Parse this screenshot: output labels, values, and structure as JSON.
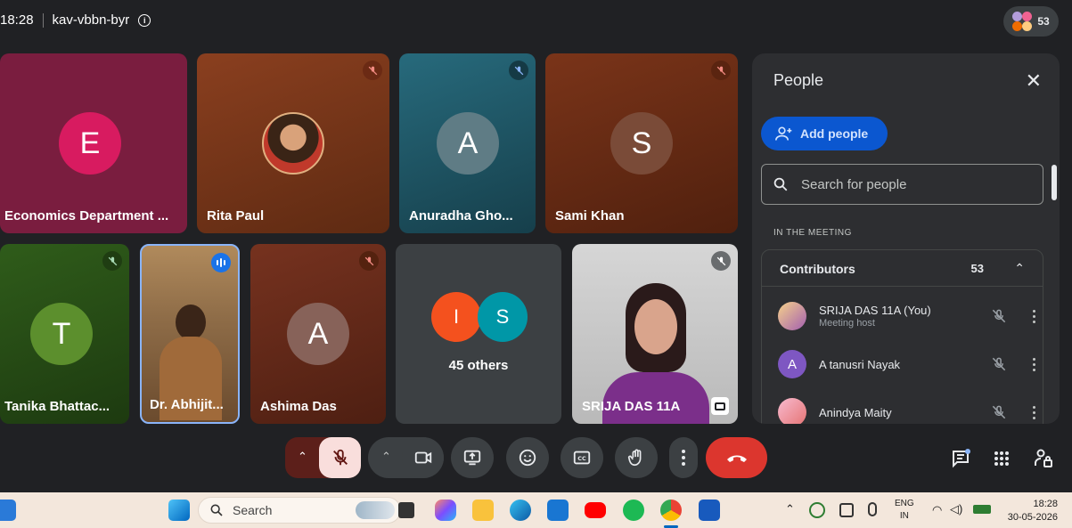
{
  "topbar": {
    "time": "18:28",
    "meeting_code": "kav-vbbn-byr",
    "participant_count": "53"
  },
  "tiles": [
    {
      "name": "Economics Department ...",
      "initial": "E",
      "mic_muted": false,
      "bg": "#7a1d3f",
      "avatar_color": "#d81b60"
    },
    {
      "name": "Rita Paul",
      "initial": "",
      "mic_muted": true,
      "bg": "#7a3519",
      "avatar_color": "#c97f43"
    },
    {
      "name": "Anuradha Gho...",
      "initial": "A",
      "mic_muted": true,
      "bg": "#1d5161",
      "avatar_color": "#5f7c85"
    },
    {
      "name": "Sami Khan",
      "initial": "S",
      "mic_muted": true,
      "bg": "#6d2e16",
      "avatar_color": "#7a4b38"
    },
    {
      "name": "Tanika Bhattac...",
      "initial": "T",
      "mic_muted": true,
      "bg": "#254a16",
      "avatar_color": "#5c8f2d"
    },
    {
      "name": "Dr. Abhijit...",
      "initial": "",
      "mic_muted": false,
      "speaking": true,
      "bg": "#8a6a48",
      "avatar_color": ""
    },
    {
      "name": "Ashima Das",
      "initial": "A",
      "mic_muted": true,
      "bg": "#6a2a1b",
      "avatar_color": "#876259"
    },
    {
      "name": "45 others",
      "initials": [
        "I",
        "S"
      ],
      "avatar_colors": [
        "#f4511e",
        "#0097a7"
      ],
      "bg": "#3c4043"
    },
    {
      "name": "SRIJA DAS 11A",
      "initial": "",
      "mic_muted": true,
      "bg": "#c4c4c4",
      "avatar_color": ""
    }
  ],
  "panel": {
    "title": "People",
    "add_people": "Add people",
    "search_placeholder": "Search for people",
    "in_meeting_label": "IN THE MEETING",
    "section_title": "Contributors",
    "section_count": "53",
    "participants": [
      {
        "name": "SRIJA DAS 11A (You)",
        "sub": "Meeting host",
        "avatar": "",
        "avatar_color": "#a35fb0"
      },
      {
        "name": "A tanusri Nayak",
        "sub": "",
        "avatar": "A",
        "avatar_color": "#7e57c2"
      },
      {
        "name": "Anindya Maity",
        "sub": "",
        "avatar": "",
        "avatar_color": "#e57373"
      }
    ]
  },
  "controls": {
    "mic_state": "off",
    "end_call_color": "#dc362e"
  },
  "taskbar": {
    "search_label": "Search",
    "lang_top": "ENG",
    "lang_bottom": "IN",
    "clock_time": "18:28",
    "clock_date": "30-05-2026"
  }
}
